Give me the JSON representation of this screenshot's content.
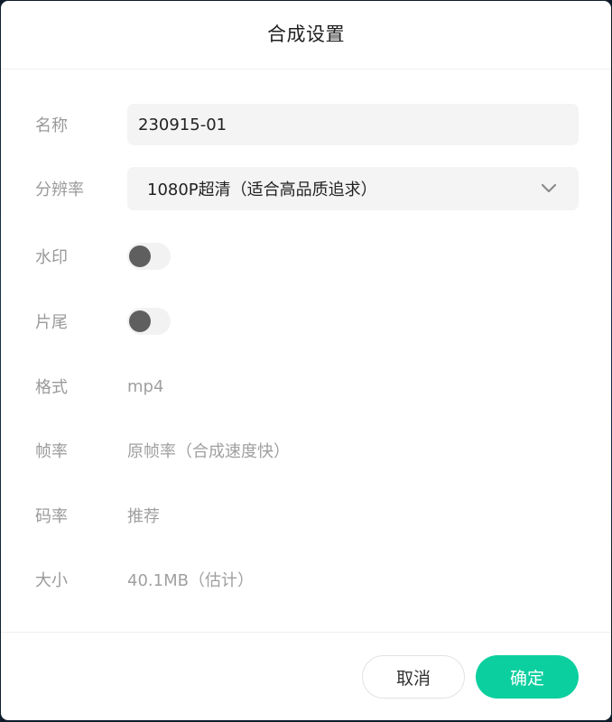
{
  "dialog": {
    "title": "合成设置"
  },
  "form": {
    "name": {
      "label": "名称",
      "value": "230915-01"
    },
    "resolution": {
      "label": "分辨率",
      "selected": "1080P超清（适合高品质追求）"
    },
    "watermark": {
      "label": "水印",
      "enabled": false
    },
    "ending": {
      "label": "片尾",
      "enabled": false
    },
    "format": {
      "label": "格式",
      "value": "mp4"
    },
    "framerate": {
      "label": "帧率",
      "value": "原帧率（合成速度快）"
    },
    "bitrate": {
      "label": "码率",
      "value": "推荐"
    },
    "size": {
      "label": "大小",
      "value": "40.1MB（估计）"
    }
  },
  "footer": {
    "cancel_label": "取消",
    "confirm_label": "确定"
  },
  "colors": {
    "accent": "#0ccf9f",
    "toggle_off_knob": "#5f5f5f"
  },
  "icons": {
    "select_chevron": "chevron-down-icon"
  }
}
